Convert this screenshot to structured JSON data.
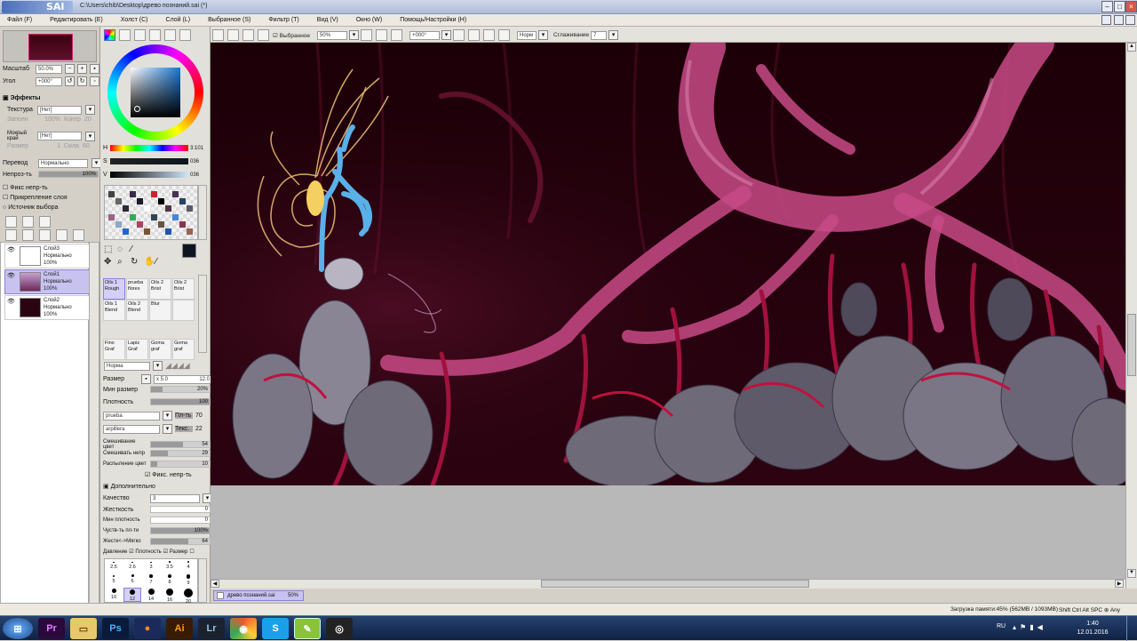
{
  "app": {
    "logo_text": "SAI",
    "title": "C:\\Users\\chib\\Desktop\\древо познаний.sai (*)"
  },
  "menu": [
    "Файл (F)",
    "Редактировать (E)",
    "Холст (C)",
    "Слой (L)",
    "Выбранное (S)",
    "Фильтр (T)",
    "Вид (V)",
    "Окно (W)",
    "Помощь/Настройки (H)"
  ],
  "navigator": {
    "zoom_label": "Масштаб",
    "zoom_value": "50.0%",
    "angle_label": "Угол",
    "angle_value": "+000°"
  },
  "effects": {
    "header": "Эффекты",
    "texture_label": "Текстура",
    "texture_value": "[Нет]",
    "texture_sub1": "Заполн",
    "texture_sub1_val": "100%",
    "texture_sub2": "Контр",
    "texture_sub2_val": "20",
    "wet_label": "Мокрый край",
    "wet_value": "[Нет]",
    "wet_sub1": "Размер",
    "wet_sub1_val": "1",
    "wet_sub2": "Сила",
    "wet_sub2_val": "60"
  },
  "layer_props": {
    "blend_label": "Перевод",
    "blend_value": "Нормально",
    "opacity_label": "Непроз-ть",
    "opacity_value": "100%",
    "opacity_level": 1.0,
    "check1": "Фикс непр-ть",
    "check2": "Прикрепление слоя",
    "check3": "Источник выбора"
  },
  "layers": [
    {
      "name": "Слой3",
      "mode": "Нормально",
      "opacity": "100%",
      "selected": false
    },
    {
      "name": "Слой1",
      "mode": "Нормально",
      "opacity": "100%",
      "selected": true
    },
    {
      "name": "Слой2",
      "mode": "Нормально",
      "opacity": "100%",
      "selected": false
    }
  ],
  "color": {
    "h_label": "H",
    "h_value": "3:101",
    "s_label": "S",
    "s_value": "036",
    "v_label": "V",
    "v_value": "036",
    "current": "#0d1620",
    "secondary": "#ffffff"
  },
  "brushes": [
    [
      "Oils 1\nRough",
      "prueba\nflores",
      "Oils 2\nBrist",
      "Oils 2\nBrist"
    ],
    [
      "Oils 1\nBlend",
      "Oils 2\nBlend",
      "Blur",
      ""
    ],
    [
      "Fino\nGraf",
      "Lapiz\nGraf",
      "Goma\ngraf",
      "Goma\ngraf"
    ]
  ],
  "brush_settings": {
    "mode": "Норма",
    "size_label": "Размер",
    "size_mult": "x 5.0",
    "size_value": "12.0",
    "minsize_label": "Мин размер",
    "minsize_value": "20%",
    "minsize_level": 0.2,
    "density_label": "Плотность",
    "density_value": "100",
    "density_level": 1.0,
    "shape_name": "prueba",
    "shape_label": "Пл-ть",
    "shape_value": "70",
    "texture_name": "arpillera",
    "texture_label": "Текс.",
    "texture_value": "22",
    "mix_label": "Смешивание цвет",
    "mix_value": "54",
    "mix_level": 0.54,
    "dilute_label": "Смешивать непр",
    "dilute_value": "29",
    "dilute_level": 0.29,
    "persist_label": "Распыление цвет",
    "persist_value": "10",
    "persist_level": 0.1,
    "keep_opacity": "Фикс. непр-ть",
    "extra_header": "Дополнительно",
    "quality_label": "Качество",
    "quality_value": "3",
    "hardness_label": "Жесткость",
    "hardness_value": "0",
    "mindensity_label": "Мин плотность",
    "mindensity_value": "0",
    "maxpress_label": "Чуств-ть пл-ти",
    "maxpress_value": "100%",
    "maxpress_level": 1.0,
    "hardsoft_label": "Жестк<->Мягко",
    "hardsoft_value": "64",
    "hardsoft_level": 0.64,
    "pressure_label": "Давление",
    "pressure_density": "Плотность",
    "pressure_size": "Размер"
  },
  "brush_sizes": [
    [
      "2.5",
      "2.6",
      "3",
      "3.5",
      "4"
    ],
    [
      "5",
      "6",
      "7",
      "8",
      "9"
    ],
    [
      "10",
      "12",
      "14",
      "16",
      "20"
    ]
  ],
  "toolbar": {
    "selection_label": "Выбранное",
    "zoom_value": "50%",
    "angle_value": "+000°",
    "mode_value": "Норм",
    "stab_label": "Сглаживание",
    "stab_value": "7"
  },
  "doc_tab": {
    "name": "древо познаний.sai",
    "zoom": "50%"
  },
  "status": {
    "memory": "Загрузка памяти:45% (562MB / 1093MB)",
    "keys": "Shift Ctrl Alt SPC ⊕ Any"
  },
  "taskbar": {
    "apps": [
      "start-button",
      "premiere-icon",
      "explorer-icon",
      "photoshop-icon",
      "firefox-icon",
      "illustrator-icon",
      "lightroom-icon",
      "chrome-icon",
      "skype-icon",
      "sai-icon",
      "obs-icon"
    ],
    "lang": "RU",
    "time": "1:40",
    "date": "12.01.2016"
  }
}
